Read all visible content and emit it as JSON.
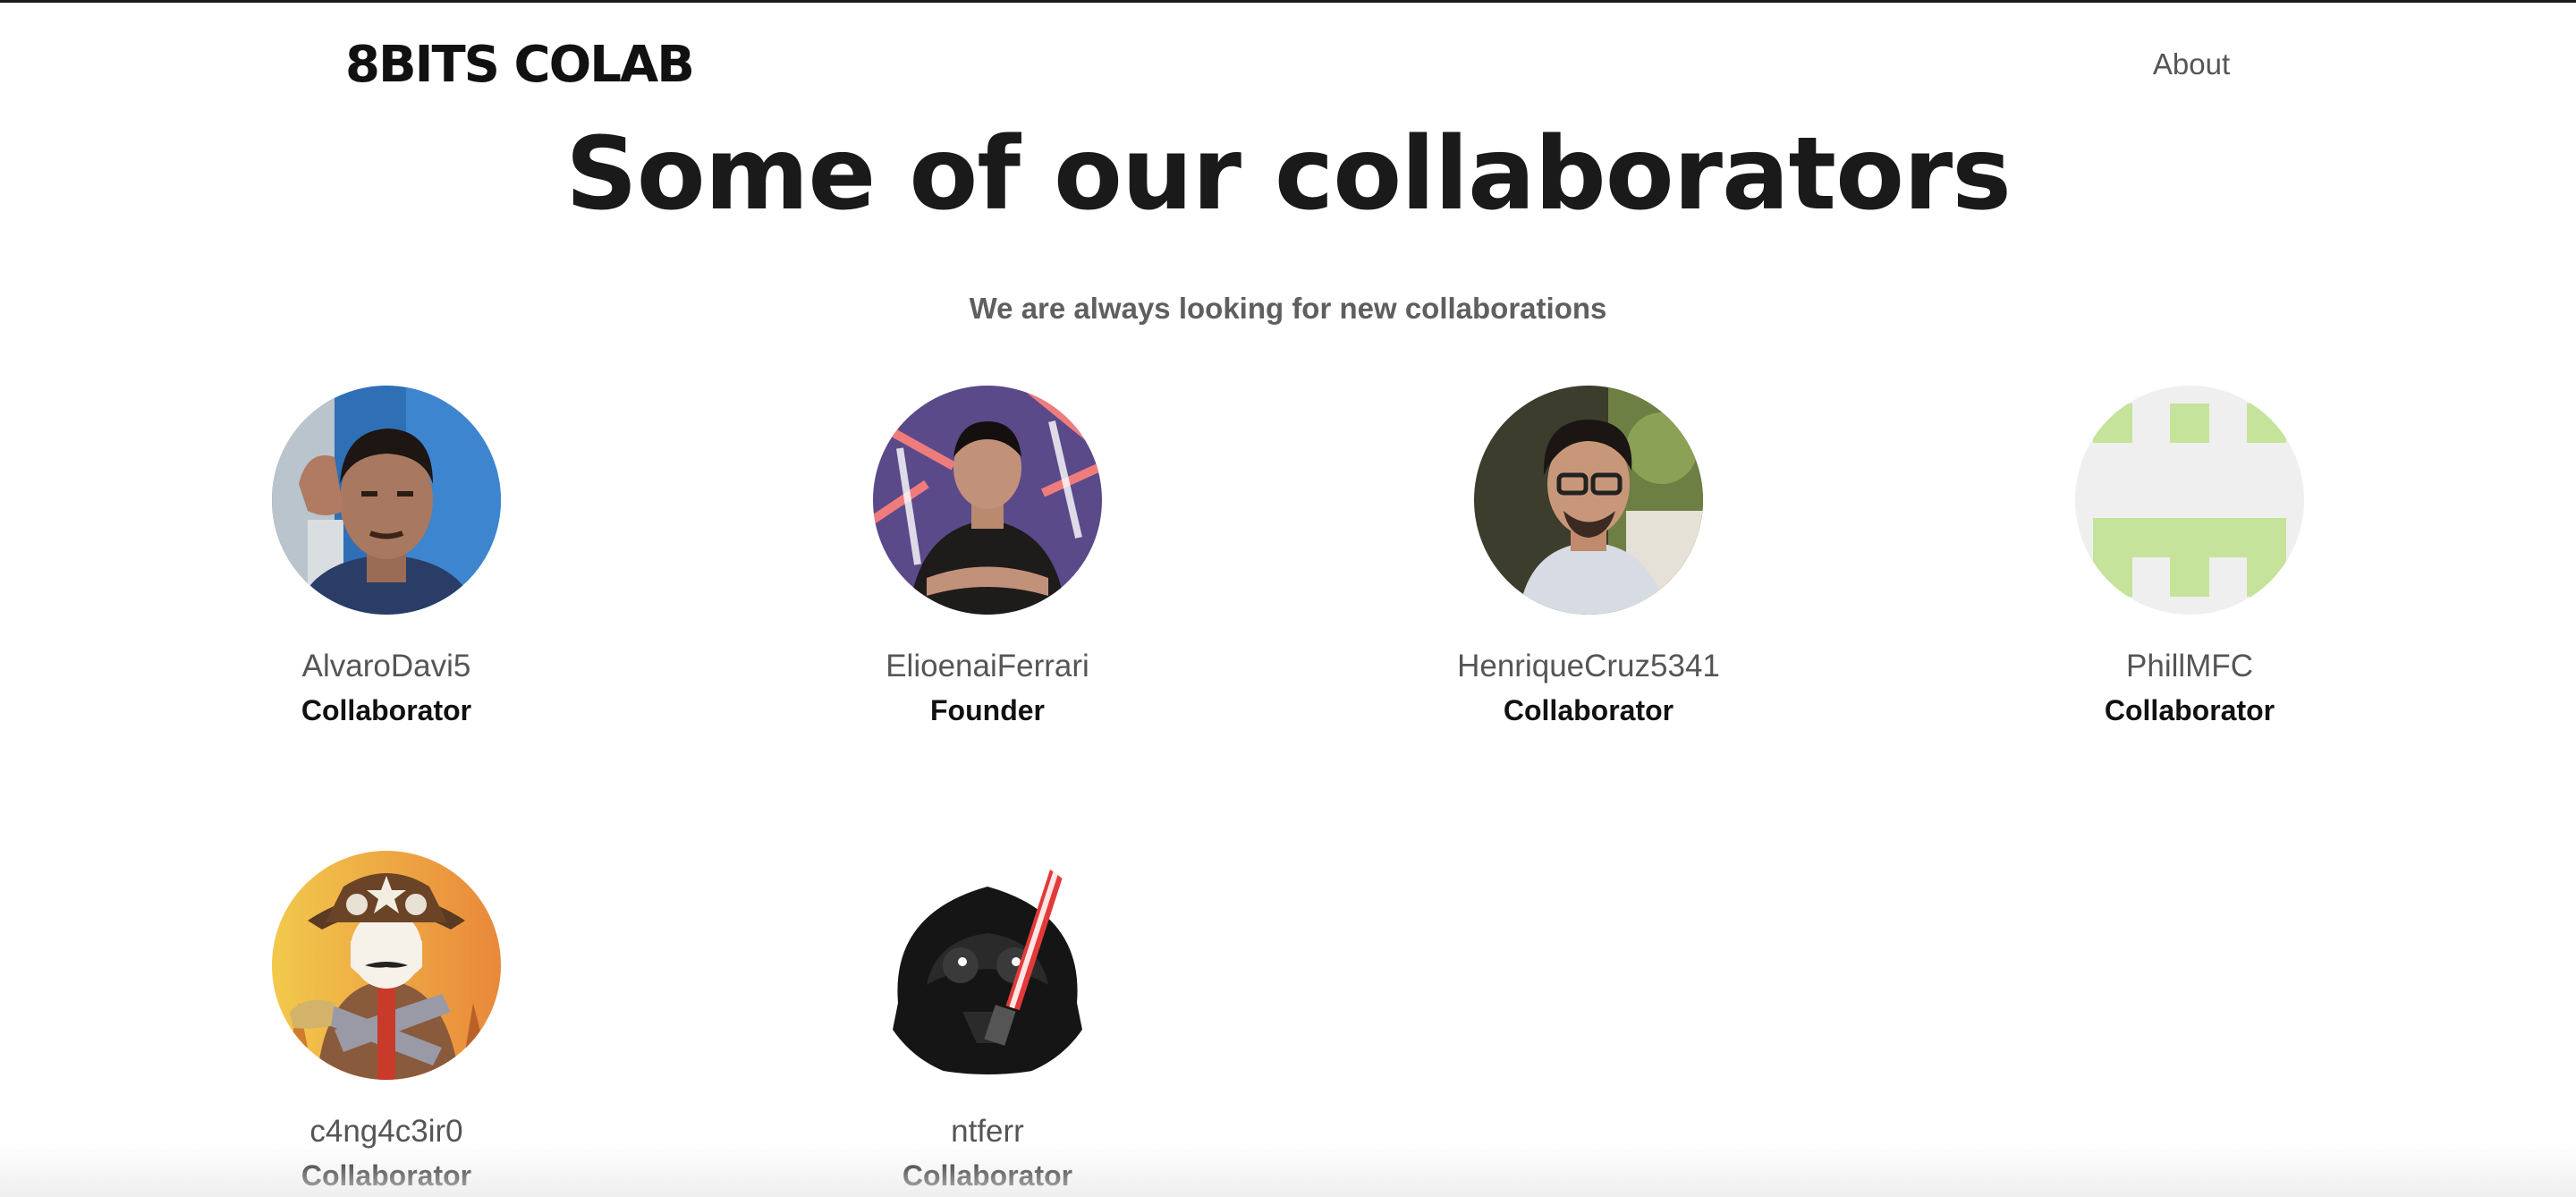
{
  "header": {
    "brand": "8BITS COLAB",
    "nav": [
      {
        "label": "About"
      }
    ]
  },
  "hero": {
    "title": "Some of our collaborators",
    "subtitle": "We are always looking for new collaborations"
  },
  "collaborators": [
    {
      "name": "AlvaroDavi5",
      "role": "Collaborator",
      "avatar": "profile-photo"
    },
    {
      "name": "ElioenaiFerrari",
      "role": "Founder",
      "avatar": "profile-photo"
    },
    {
      "name": "HenriqueCruz5341",
      "role": "Collaborator",
      "avatar": "profile-photo"
    },
    {
      "name": "PhillMFC",
      "role": "Collaborator",
      "avatar": "pixel-identicon"
    },
    {
      "name": "c4ng4c3ir0",
      "role": "Collaborator",
      "avatar": "cangaceiro-mask-illustration"
    },
    {
      "name": "ntferr",
      "role": "Collaborator",
      "avatar": "darth-vader-illustration"
    }
  ],
  "colors": {
    "title": "#1a1a1a",
    "subtitle": "#5f5f5f",
    "name": "#555555",
    "role": "#111111",
    "identicon_green": "#c5e39a",
    "identicon_bg": "#efefef"
  }
}
